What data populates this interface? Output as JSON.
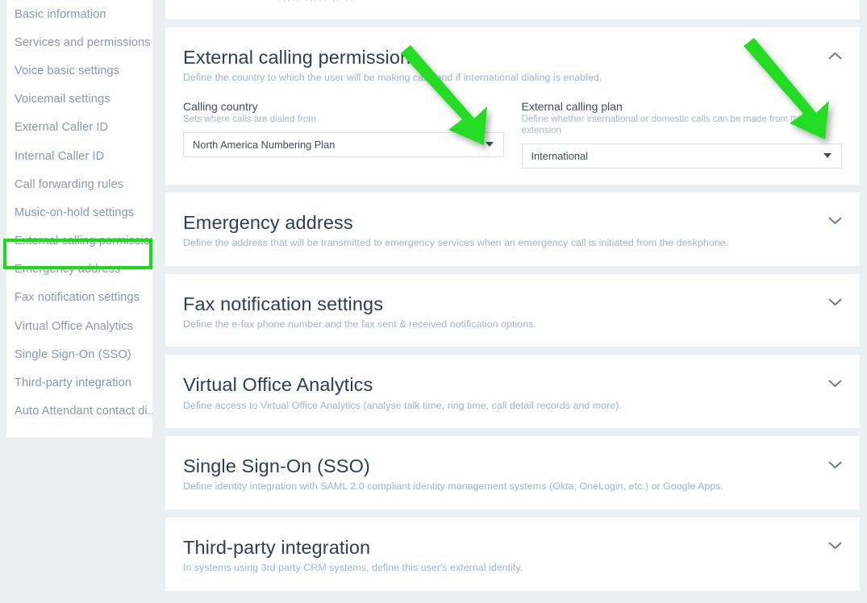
{
  "sidebar": {
    "items": [
      {
        "label": "Basic information"
      },
      {
        "label": "Services and permissions"
      },
      {
        "label": "Voice basic settings"
      },
      {
        "label": "Voicemail settings"
      },
      {
        "label": "External Caller ID"
      },
      {
        "label": "Internal Caller ID"
      },
      {
        "label": "Call forwarding rules"
      },
      {
        "label": "Music-on-hold settings"
      },
      {
        "label": "External calling permission"
      },
      {
        "label": "Emergency address"
      },
      {
        "label": "Fax notification settings"
      },
      {
        "label": "Virtual Office Analytics"
      },
      {
        "label": "Single Sign-On (SSO)"
      },
      {
        "label": "Third-party integration"
      },
      {
        "label": "Auto Attendant contact di..."
      }
    ],
    "active_index": 8
  },
  "annotations": {
    "highlight_color": "#11e011",
    "arrow_color": "#22dd22",
    "highlight_target": "External calling permission",
    "arrow_targets": [
      "Calling country dropdown",
      "External calling plan dropdown"
    ]
  },
  "main": {
    "partial_top_card": {
      "sliver_text": "·····    ·····   ··  ··"
    },
    "sections": [
      {
        "title": "External calling permission",
        "description": "Define the country to which the user will be making calls and if international dialing is enabled.",
        "expanded": true,
        "chevron": "chevron-up-icon",
        "fields": [
          {
            "label": "Calling country",
            "hint": "Sets where calls are dialed from",
            "value": "North America Numbering Plan",
            "control": "dropdown"
          },
          {
            "label": "External calling plan",
            "hint": "Define whether international or domestic calls can be made from this extension",
            "value": "International",
            "control": "dropdown"
          }
        ]
      },
      {
        "title": "Emergency address",
        "description": "Define the address that will be transmitted to emergency services when an emergency call is initiated from the deskphone.",
        "expanded": false,
        "chevron": "chevron-down-icon"
      },
      {
        "title": "Fax notification settings",
        "description": "Define the e-fax phone number and the fax sent & received notification options.",
        "expanded": false,
        "chevron": "chevron-down-icon"
      },
      {
        "title": "Virtual Office Analytics",
        "description": "Define access to Virtual Office Analytics (analyse talk time, ring time, call detail records and more).",
        "expanded": false,
        "chevron": "chevron-down-icon"
      },
      {
        "title": "Single Sign-On (SSO)",
        "description": "Define identity integration with SAML 2.0 compliant identity management systems (Okta, OneLogin, etc.) or Google Apps.",
        "expanded": false,
        "chevron": "chevron-down-icon"
      },
      {
        "title": "Third-party integration",
        "description": "In systems using 3rd party CRM systems, define this user's external identity.",
        "expanded": false,
        "chevron": "chevron-down-icon"
      }
    ]
  },
  "colors": {
    "page_background": "#eceff1",
    "card_background": "#ffffff",
    "title_text": "#2f3d51",
    "muted_text": "#a3b3ca",
    "nav_text": "#8b97a8",
    "field_border": "#d7dde4"
  }
}
